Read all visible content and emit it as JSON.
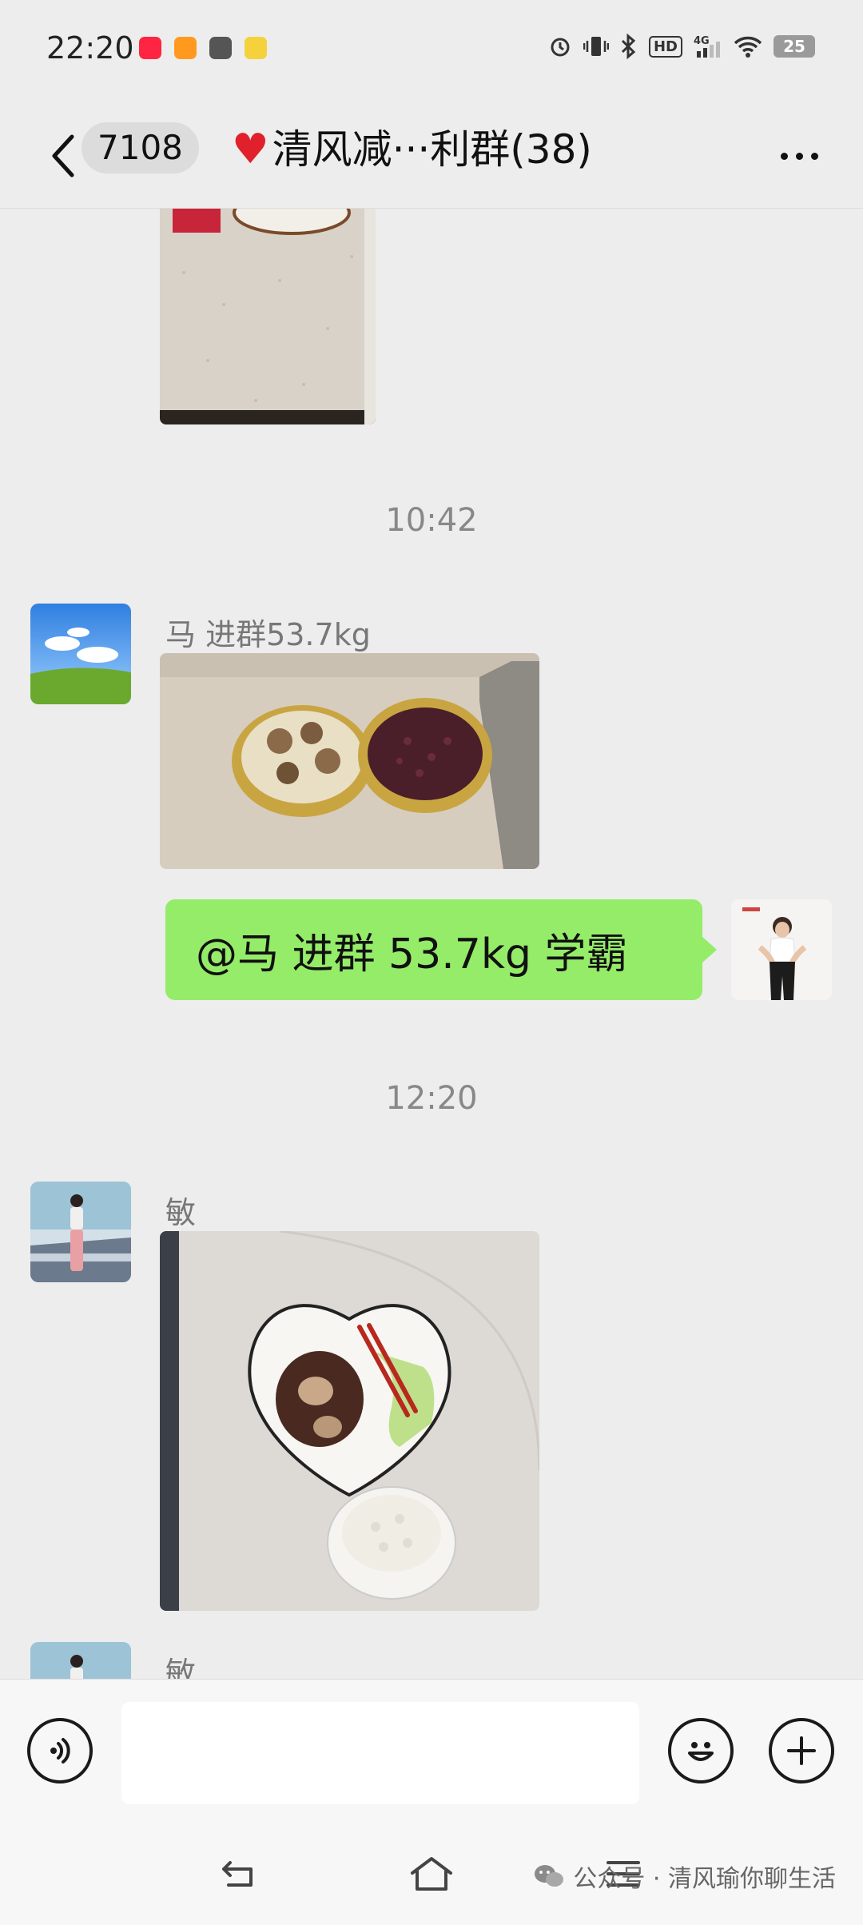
{
  "status_bar": {
    "time": "22:20",
    "hd_label": "HD",
    "network_label": "4G",
    "battery_level": "25",
    "icons": [
      "alarm-icon",
      "vibrate-icon",
      "bluetooth-icon",
      "hd-icon",
      "signal-icon",
      "wifi-icon",
      "battery-icon"
    ]
  },
  "header": {
    "unread_count": "7108",
    "title": "清风减···利群(38)",
    "heart": "❤️"
  },
  "messages": {
    "time_1": "10:42",
    "sender_1": "马 进群53.7kg",
    "reply_text": "@马 进群 53.7kg  学霸",
    "time_2": "12:20",
    "sender_2": "敏",
    "sender_3": "敏"
  },
  "input": {
    "placeholder": ""
  },
  "watermark": {
    "text": "公众号 · 清风瑜你聊生活"
  },
  "colors": {
    "background": "#ededed",
    "bubble_green": "#95ec69",
    "input_bar": "#f7f7f7"
  }
}
